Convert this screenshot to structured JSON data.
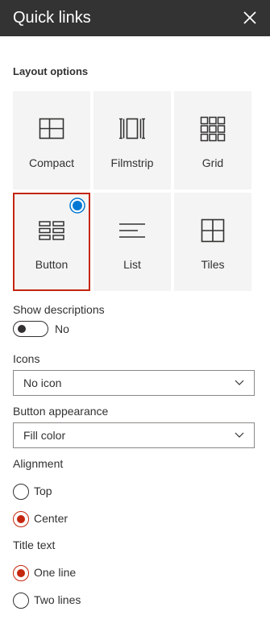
{
  "header": {
    "title": "Quick links",
    "close_icon": "close-icon"
  },
  "layout": {
    "label": "Layout options",
    "options": [
      {
        "label": "Compact",
        "icon": "compact-layout-icon"
      },
      {
        "label": "Filmstrip",
        "icon": "filmstrip-layout-icon"
      },
      {
        "label": "Grid",
        "icon": "grid-layout-icon"
      },
      {
        "label": "Button",
        "icon": "button-layout-icon",
        "selected": true
      },
      {
        "label": "List",
        "icon": "list-layout-icon"
      },
      {
        "label": "Tiles",
        "icon": "tiles-layout-icon"
      }
    ]
  },
  "show_descriptions": {
    "label": "Show descriptions",
    "state": "No",
    "on": false
  },
  "icons": {
    "label": "Icons",
    "value": "No icon"
  },
  "button_appearance": {
    "label": "Button appearance",
    "value": "Fill color"
  },
  "alignment": {
    "label": "Alignment",
    "options": [
      {
        "label": "Top",
        "checked": false
      },
      {
        "label": "Center",
        "checked": true
      }
    ]
  },
  "title_text": {
    "label": "Title text",
    "options": [
      {
        "label": "One line",
        "checked": true
      },
      {
        "label": "Two lines",
        "checked": false
      }
    ]
  },
  "colors": {
    "header_bg": "#333333",
    "accent": "#c4260e",
    "check_badge": "#0078d4",
    "tile_bg": "#f4f4f4"
  }
}
